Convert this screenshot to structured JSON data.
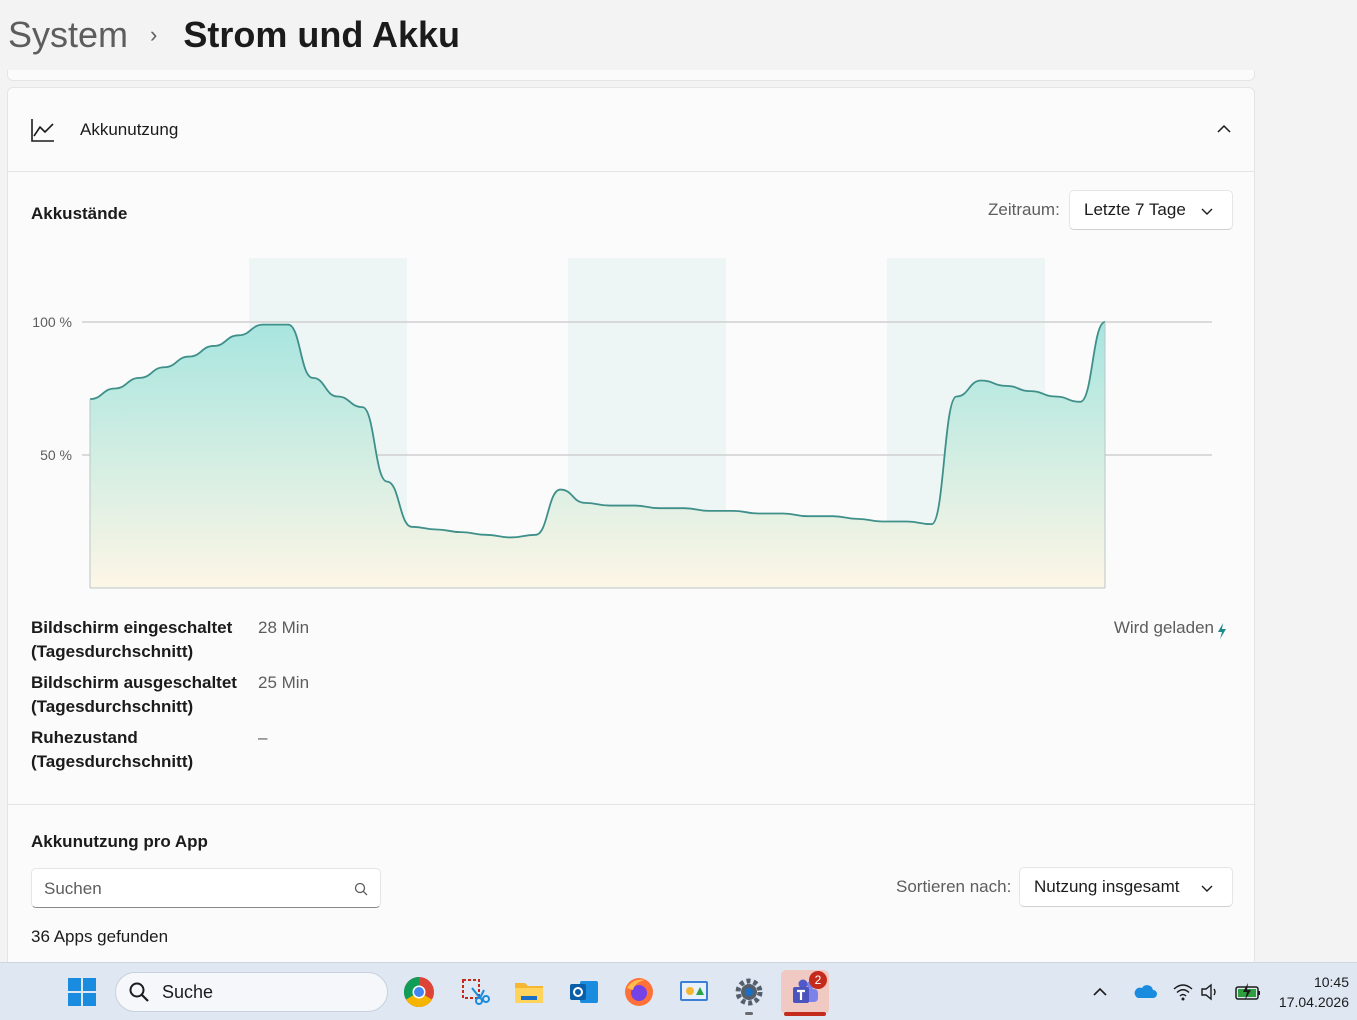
{
  "breadcrumb": {
    "parent": "System",
    "separator": "›",
    "current": "Strom und Akku"
  },
  "section": {
    "title": "Akkunutzung",
    "icon": "line-chart-icon",
    "collapse_icon": "chevron-up-icon"
  },
  "battery_levels": {
    "title": "Akkustände",
    "period_label": "Zeitraum:",
    "period_value": "Letzte 7 Tage",
    "charging_label": "Wird geladen",
    "charging_icon": "lightning-icon"
  },
  "chart_data": {
    "type": "area",
    "yticks": [
      "100 %",
      "50 %"
    ],
    "ylim": [
      0,
      100
    ],
    "x": [
      0,
      1,
      2,
      3,
      4,
      5,
      6,
      7,
      8,
      9,
      10,
      11,
      12,
      13,
      14,
      15,
      16,
      17,
      18,
      19,
      20,
      21,
      22,
      23,
      24,
      25,
      26,
      27,
      28,
      29,
      30,
      31,
      32,
      33,
      34,
      35,
      36,
      37,
      38,
      39,
      40,
      41
    ],
    "values": [
      71,
      75,
      79,
      83,
      87,
      91,
      95,
      99,
      99,
      79,
      72,
      68,
      40,
      23,
      22,
      21,
      20,
      19,
      20,
      37,
      32,
      31,
      31,
      30,
      30,
      29,
      29,
      28,
      28,
      27,
      27,
      26,
      25,
      25,
      24,
      72,
      78,
      76,
      74,
      72,
      70,
      100
    ],
    "shaded_bands": 3,
    "grid": true,
    "legend": "none",
    "colors": {
      "line": "#3f8f8a",
      "fill_top": "#a7e5df",
      "fill_bottom": "#fdf6e6",
      "grid": "#cfcfcf",
      "band": "#eef6f5"
    }
  },
  "stats": [
    {
      "label": "Bildschirm eingeschaltet (Tagesdurchschnitt)",
      "value": "28 Min"
    },
    {
      "label": "Bildschirm ausgeschaltet (Tagesdurchschnitt)",
      "value": "25 Min"
    },
    {
      "label": "Ruhezustand (Tagesdurchschnitt)",
      "value": "–"
    }
  ],
  "per_app": {
    "title": "Akkunutzung pro App",
    "search_placeholder": "Suchen",
    "sort_label": "Sortieren nach:",
    "sort_value": "Nutzung insgesamt",
    "count_text": "36 Apps gefunden"
  },
  "taskbar": {
    "search_placeholder": "Suche",
    "apps": [
      "start-icon",
      "chrome-icon",
      "snipping-tool-icon",
      "file-explorer-icon",
      "outlook-icon",
      "firefox-icon",
      "control-panel-icon",
      "settings-icon",
      "teams-icon"
    ],
    "teams_badge": "2",
    "tray": [
      "chevron-up-icon",
      "onedrive-icon",
      "wifi-icon",
      "volume-icon",
      "battery-charging-icon"
    ],
    "time": "10:45",
    "date": "17.04.2026"
  }
}
